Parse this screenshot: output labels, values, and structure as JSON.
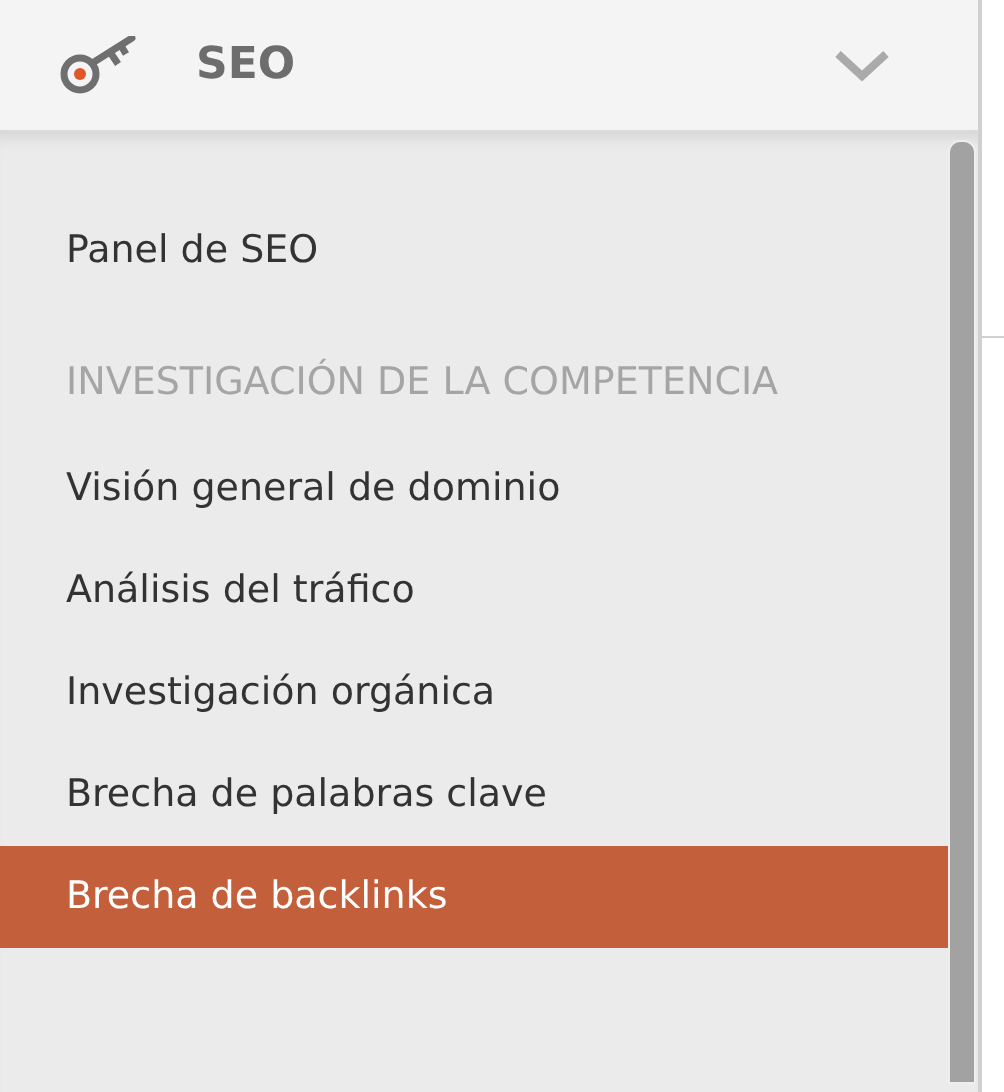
{
  "header": {
    "title": "SEO"
  },
  "menu": [
    {
      "kind": "link",
      "label": "Panel de SEO",
      "selected": false
    },
    {
      "kind": "heading",
      "label": "INVESTIGACIÓN DE LA COMPETENCIA"
    },
    {
      "kind": "link",
      "label": "Visión general de dominio",
      "selected": false
    },
    {
      "kind": "link",
      "label": "Análisis del tráfico",
      "selected": false
    },
    {
      "kind": "link",
      "label": "Investigación orgánica",
      "selected": false
    },
    {
      "kind": "link",
      "label": "Brecha de palabras clave",
      "selected": false
    },
    {
      "kind": "link",
      "label": "Brecha de backlinks",
      "selected": true
    }
  ]
}
